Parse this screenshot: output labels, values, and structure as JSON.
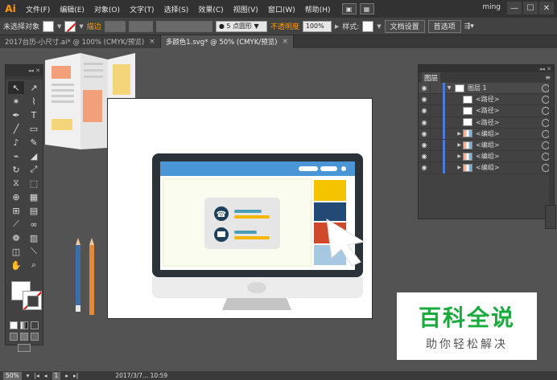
{
  "app": {
    "logo": "Ai"
  },
  "menu": [
    "文件(F)",
    "编辑(E)",
    "对象(O)",
    "文字(T)",
    "选择(S)",
    "效果(C)",
    "视图(V)",
    "窗口(W)",
    "帮助(H)"
  ],
  "user": "ming",
  "window_controls": [
    "—",
    "☐",
    "✕"
  ],
  "control_bar": {
    "selection_status": "未选择对象",
    "stroke_label": "描边",
    "brush_value": "5 点圆形",
    "opacity_label": "不透明度",
    "opacity_value": "100%",
    "style_label": "样式:",
    "doc_setup_button": "文档设置",
    "preferences_button": "首选项"
  },
  "tabs": [
    {
      "label": "2017台历-小尺寸.ai* @ 100% (CMYK/预览)",
      "active": false
    },
    {
      "label": "多颜色1.svg* @ 50% (CMYK/预览)",
      "active": true
    }
  ],
  "layers_panel": {
    "tab": "图层",
    "rows": [
      {
        "name": "图层 1",
        "type": "layer"
      },
      {
        "name": "<路径>",
        "type": "path"
      },
      {
        "name": "<路径>",
        "type": "path"
      },
      {
        "name": "<路径>",
        "type": "path"
      },
      {
        "name": "<编组>",
        "type": "group"
      },
      {
        "name": "<编组>",
        "type": "group"
      },
      {
        "name": "<编组>",
        "type": "group"
      },
      {
        "name": "<编组>",
        "type": "group"
      }
    ]
  },
  "watermark": {
    "title": "百科全说",
    "subtitle": "助你轻松解决"
  },
  "status_bar": {
    "zoom": "50%",
    "page": "1",
    "datetime": "2017/3/7... 10:59"
  },
  "colors": {
    "accent_orange": "#ff9a00",
    "layer_blue": "#4b7bd8",
    "watermark_green": "#1aab3c"
  }
}
